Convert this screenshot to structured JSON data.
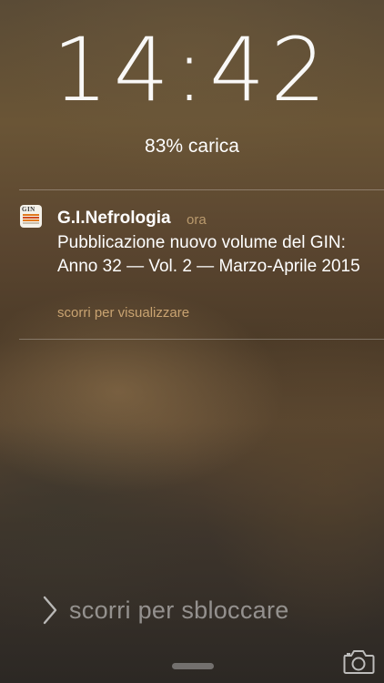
{
  "lockscreen": {
    "time": "14:42",
    "battery": "83% carica",
    "unlock_hint": "scorri per sbloccare"
  },
  "notification": {
    "app_icon": "gin-app-icon",
    "app_icon_text": "GIN",
    "app_name": "G.I.Nefrologia",
    "time": "ora",
    "message": "Pubblicazione nuovo volume del GIN: Anno 32 — Vol. 2 — Marzo-Aprile 2015",
    "action_hint": "scorri per visualizzare"
  },
  "icons": {
    "unlock_chevron": "chevron-right-icon",
    "camera": "camera-icon",
    "grabber": "control-center-grabber"
  },
  "colors": {
    "accent_time": "#b99a6d",
    "accent_hint": "#c9a371"
  }
}
